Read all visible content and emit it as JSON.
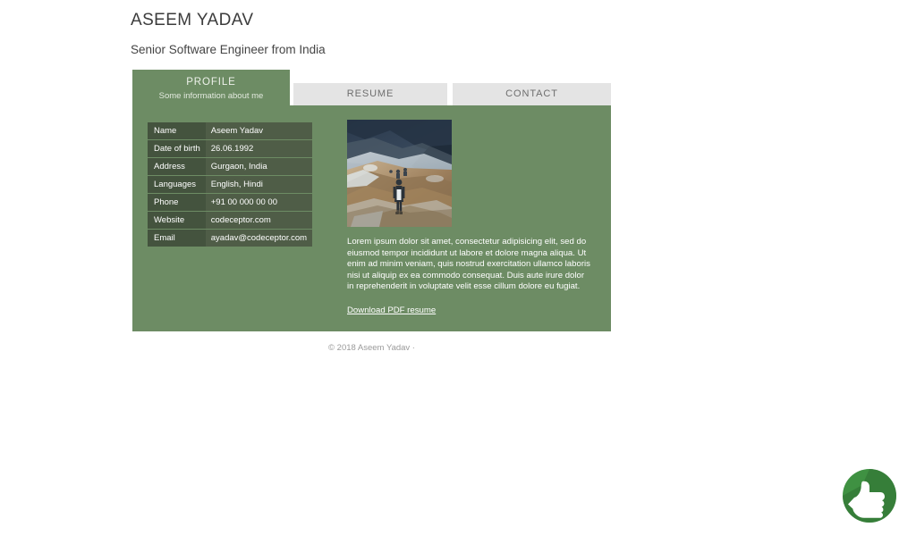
{
  "header": {
    "title": "ASEEM YADAV",
    "subtitle": "Senior Software Engineer from India"
  },
  "tabs": [
    {
      "label": "PROFILE",
      "sublabel": "Some information about me",
      "active": true
    },
    {
      "label": "RESUME",
      "sublabel": "",
      "active": false
    },
    {
      "label": "CONTACT",
      "sublabel": "",
      "active": false
    }
  ],
  "profile": {
    "table": {
      "rows": [
        {
          "key": "Name",
          "value": "Aseem Yadav"
        },
        {
          "key": "Date of birth",
          "value": "26.06.1992"
        },
        {
          "key": "Address",
          "value": "Gurgaon, India"
        },
        {
          "key": "Languages",
          "value": "English, Hindi"
        },
        {
          "key": "Phone",
          "value": "+91 00 000 00 00"
        },
        {
          "key": "Website",
          "value": "codeceptor.com"
        },
        {
          "key": "Email",
          "value": "ayadav@codeceptor.com"
        }
      ]
    },
    "photo_alt": "person standing on a snowy mountain trail",
    "bio": "Lorem ipsum dolor sit amet, consectetur adipisicing elit, sed do eiusmod tempor incididunt ut labore et dolore magna aliqua. Ut enim ad minim veniam, quis nostrud exercitation ullamco laboris nisi ut aliquip ex ea commodo consequat. Duis aute irure dolor in reprehenderit in voluptate velit esse cillum dolore eu fugiat.",
    "download_label": "Download PDF resume"
  },
  "footer": {
    "copyright": "© 2018 Aseem Yadav ·"
  },
  "logo": {
    "name": "thumbs-up-logo"
  },
  "colors": {
    "panel_green": "#6d8c64",
    "table_key_green": "#44533e",
    "table_value_green": "#4f5d47",
    "tab_inactive_gray": "#e4e4e4",
    "logo_green": "#3f9142",
    "logo_green_dark": "#2f7033"
  }
}
